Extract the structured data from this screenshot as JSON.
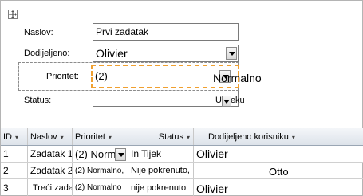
{
  "form": {
    "title_label": "Naslov:",
    "title_value": "Prvi zadatak",
    "assigned_label": "Dodijeljeno:",
    "assigned_value": "Olivier",
    "priority_label": "Prioritet:",
    "priority_value": "(2)",
    "priority_overlay": "Normalno",
    "status_label": "Status:",
    "status_overlay": "U tijeku"
  },
  "table": {
    "columns": [
      "ID",
      "Naslov",
      "Prioritet",
      "Status",
      "Dodijeljeno korisniku"
    ],
    "rows": [
      {
        "id": "1",
        "title": "Zadatak 1",
        "priority": "(2) Norm",
        "status": "In Tijek",
        "assigned": "Olivier"
      },
      {
        "id": "2",
        "title": "Zadatak 2",
        "priority": "(2) Normalno,",
        "status": "Nije pokrenuto,",
        "assigned": "Otto"
      },
      {
        "id": "3",
        "title": "Treći zadatak",
        "priority": "(2) Normalno",
        "status": "nije pokrenuto",
        "assigned": "Olivier"
      }
    ]
  }
}
